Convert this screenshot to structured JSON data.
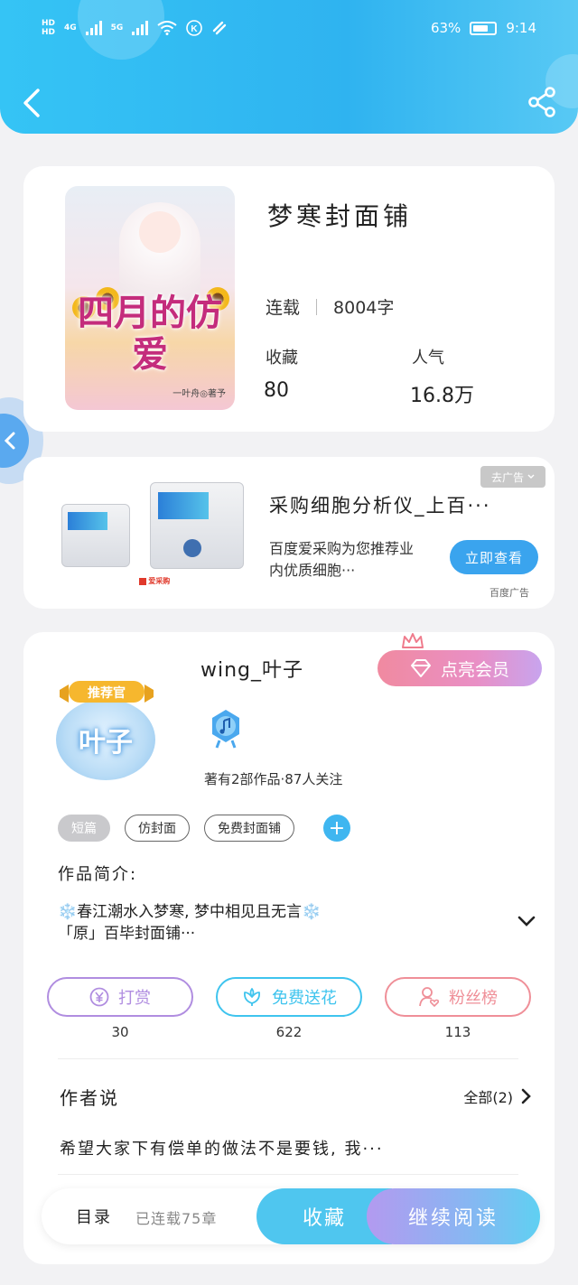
{
  "status_bar": {
    "hd1": "HD",
    "hd2": "HD",
    "net1": "4G",
    "net2": "5G",
    "battery": "63%",
    "time": "9:14"
  },
  "book": {
    "title": "梦寒封面铺",
    "status": "连载",
    "word_count": "8004字",
    "fav_label": "收藏",
    "fav_value": "80",
    "pop_label": "人气",
    "pop_value": "16.8万",
    "cover_title": "四月的仿爱",
    "cover_author": "一叶舟◎著予"
  },
  "ad": {
    "badge": "去广告",
    "title": "采购细胞分析仪_上百···",
    "desc": "百度爱采购为您推荐业内优质细胞···",
    "button": "立即查看",
    "source": "百度广告"
  },
  "author": {
    "badge": "推荐官",
    "avatar_text": "叶子",
    "name": "wing_叶子",
    "vip_button": "点亮会员",
    "meta": "著有2部作品·87人关注",
    "tags": [
      "短篇",
      "仿封面",
      "免费封面铺"
    ],
    "intro_label": "作品简介:",
    "intro_line1": "❄️春江潮水入梦寒, 梦中相见且无言❄️",
    "intro_line2": "「原」百毕封面铺···",
    "actions": [
      {
        "label": "打赏",
        "count": "30"
      },
      {
        "label": "免费送花",
        "count": "622"
      },
      {
        "label": "粉丝榜",
        "count": "113"
      }
    ],
    "says_label": "作者说",
    "says_all": "全部(2)",
    "says_text": "希望大家下有偿单的做法不是要钱, 我···"
  },
  "bottom": {
    "toc": "目录",
    "serial": "已连载75章",
    "fav": "收藏",
    "read": "继续阅读"
  },
  "colors": {
    "header": "#35c4f5",
    "reward": "#b08de0",
    "flower": "#3fc4ee",
    "fans": "#ef8f98"
  }
}
